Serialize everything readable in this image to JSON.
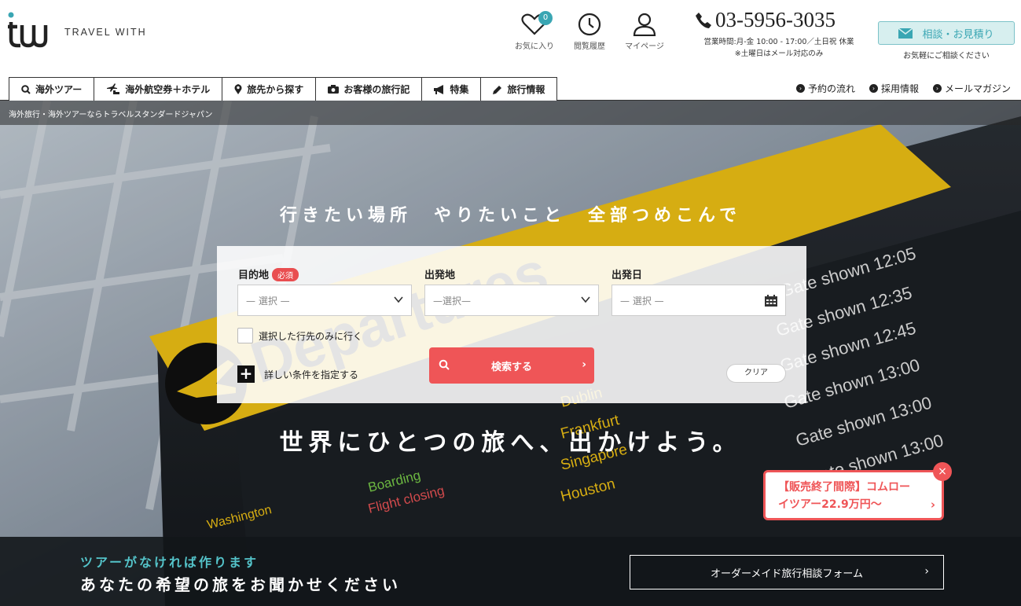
{
  "brand": {
    "name": "TRAVEL WITH"
  },
  "header": {
    "favorites": {
      "label": "お気に入り",
      "count": "0"
    },
    "history": {
      "label": "閲覧履歴"
    },
    "mypage": {
      "label": "マイページ"
    },
    "phone": "03-5956-3035",
    "hours_line1": "営業時間:月-金 10:00 - 17:00／土日祝 休業",
    "hours_line2": "※土曜日はメール対応のみ",
    "consult_button": "相談・お見積り",
    "consult_sub": "お気軽にご相談ください"
  },
  "nav": {
    "tabs": [
      {
        "label": "海外ツアー",
        "icon": "search-icon"
      },
      {
        "label": "海外航空券＋ホテル",
        "icon": "plane-bed-icon"
      },
      {
        "label": "旅先から探す",
        "icon": "map-pin-icon"
      },
      {
        "label": "お客様の旅行記",
        "icon": "camera-icon"
      },
      {
        "label": "特集",
        "icon": "megaphone-icon"
      },
      {
        "label": "旅行情報",
        "icon": "pencil-icon"
      }
    ],
    "right_links": [
      "予約の流れ",
      "採用情報",
      "メールマガジン"
    ]
  },
  "hero": {
    "breadcrumb": "海外旅行・海外ツアーならトラベルスタンダードジャパン",
    "tagline": "行きたい場所　やりたいこと　全部つめこんで",
    "slogan": "世界にひとつの旅へ、出かけよう。"
  },
  "search": {
    "destination_label": "目的地",
    "required_badge": "必須",
    "destination_placeholder": "— 選択 —",
    "departure_label": "出発地",
    "departure_placeholder": "—選択—",
    "date_label": "出発日",
    "date_placeholder": "— 選択 —",
    "only_selected_label": "選択した行先のみに行く",
    "advanced_label": "詳しい条件を指定する",
    "search_button": "検索する",
    "clear_button": "クリア"
  },
  "promo": {
    "line1": "【販売終了間際】コムロー",
    "line2": "イツアー22.9万円～",
    "close": "×"
  },
  "bottom_banner": {
    "line1": "ツアーがなければ作ります",
    "line2": "あなたの希望の旅をお聞かせください",
    "button": "オーダーメイド旅行相談フォーム"
  },
  "colors": {
    "accent": "#3aa6b3",
    "search_button": "#ef5557",
    "promo_border": "#ef5557"
  }
}
